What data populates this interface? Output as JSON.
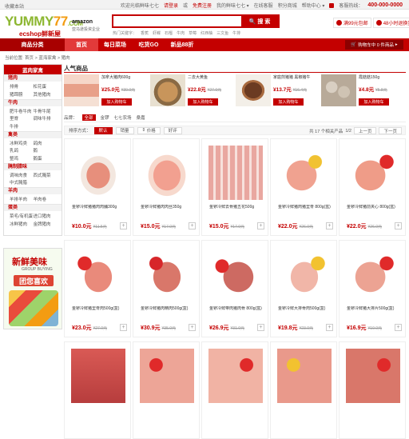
{
  "topbar": {
    "left": "收藏本站",
    "welcome": "欢迎光临鲜味七七",
    "login": "请登录",
    "or": "或",
    "register": "免费注册",
    "my": "我的鲜味七七 ▾",
    "orders": "在线客服",
    "points": "积分商城",
    "help": "帮助中心 ▾",
    "phone_label": "客服热线：",
    "phone": "400-000-0000"
  },
  "logo": {
    "brand_a": "YUMMY",
    "brand_b": "77",
    "brand_c": ".COM",
    "sub": "ecshop鲜新屋"
  },
  "amazon": {
    "name": "amazon",
    "desc": "亚马逊投资企业"
  },
  "search": {
    "placeholder": "",
    "button": "搜 索"
  },
  "hotwords": [
    "热门关键字：",
    "香蕉",
    "虾鲽",
    "石榴",
    "牛肉",
    "草莓",
    "红西柚",
    "三文鱼",
    "牛排"
  ],
  "badges": [
    {
      "label": "满99元包邮"
    },
    {
      "label": "48小时退换货"
    }
  ],
  "nav": {
    "category": "商品分类",
    "items": [
      "首页",
      "每日菜场",
      "吃货GO",
      "新品88折"
    ]
  },
  "cart": {
    "label": "购物车中 0 件商品",
    "arrow": "▸"
  },
  "breadcrumb": "当前位置: 首页 > 蓝海家禽 > 猪肉",
  "sidebar": {
    "title": "蓝肉家禽",
    "groups": [
      {
        "name": "猪肉",
        "links": [
          "排骨",
          "松花蛋",
          "猪蹄膀",
          "其他猪肉"
        ]
      },
      {
        "name": "牛肉",
        "links": [
          "肥牛卷牛肉",
          "牛骨牛尾",
          "里脊",
          "调味牛排",
          "牛排",
          ""
        ]
      },
      {
        "name": "禽类",
        "links": [
          "冰鲜鸡类",
          "鸽肉",
          "乳鸽",
          "鹅",
          "整鸡",
          "鹅蛋"
        ]
      },
      {
        "name": "腌制腊味",
        "links": [
          "调味肉食",
          "西式腌菜",
          "中式腌腊",
          ""
        ]
      },
      {
        "name": "羊肉",
        "links": [
          "羊排羊肉",
          "羊肉卷"
        ]
      },
      {
        "name": "蛋类",
        "links": [
          "菜毛/有机蛋",
          "进口猪肉",
          "冰鲜猪肉",
          "金牌猪肉"
        ]
      }
    ]
  },
  "promo": {
    "title": "新鲜美味",
    "sub": "GROUP BUYING",
    "cta": "团您喜欢"
  },
  "hot": {
    "title": "人气商品",
    "add_label": "加入购物车",
    "items": [
      {
        "name": "加拿大猪肉600g",
        "price": "¥25.0元",
        "old": "¥30.0元"
      },
      {
        "name": "二去大黄鱼",
        "price": "¥22.8元",
        "old": "¥27.0元"
      },
      {
        "name": "家庭煎猪猪 黑椒猪牛",
        "price": "¥13.7元",
        "old": "¥16.4元"
      },
      {
        "name": "霞菇菇150g",
        "price": "¥4.8元",
        "old": "¥5.8元"
      }
    ]
  },
  "brands": {
    "label": "品牌：",
    "tags": [
      "全部",
      "金锣",
      "七七农场",
      "桑嘉"
    ]
  },
  "sort": {
    "label": "排序方式：",
    "buttons": [
      "默认",
      "销量",
      "价格",
      "好评"
    ],
    "count_text": "共 17 个相关产品",
    "page": "1/2",
    "prev": "上一页",
    "next": "下一页"
  },
  "products": [
    {
      "name": "金锣冷鲜猪猪肉肉脯300g",
      "price": "¥10.0元",
      "old": "¥11.5元"
    },
    {
      "name": "金锣冷鲜猪肉肉丝350g",
      "price": "¥15.0元",
      "old": "¥17.0元"
    },
    {
      "name": "金锣冷鲜去骨猪五花500g",
      "price": "¥15.0元",
      "old": "¥17.0元"
    },
    {
      "name": "金锣冷鲜猪肉猪里脊 800g(盒)",
      "price": "¥22.0元",
      "old": "¥26.0元"
    },
    {
      "name": "金锣冷鲜猪前夹心 800g(盒)",
      "price": "¥22.0元",
      "old": "¥26.0元"
    },
    {
      "name": "金锣冷鲜猪里脊肉500g(盒)",
      "price": "¥23.0元",
      "old": "¥27.0元"
    },
    {
      "name": "金锣冷鲜猪肉精肉500g(盒)",
      "price": "¥30.9元",
      "old": "¥35.0元"
    },
    {
      "name": "金锣冷鲜带肉猪肉骨 800g(盒)",
      "price": "¥26.9元",
      "old": "¥31.0元"
    },
    {
      "name": "金锣冷鲜大排骨肉500g(盒)",
      "price": "¥19.8元",
      "old": "¥23.0元"
    },
    {
      "name": "金锣冷鲜猪大排片500g(盒)",
      "price": "¥16.9元",
      "old": "¥19.0元"
    },
    {
      "name": "",
      "price": "",
      "old": ""
    },
    {
      "name": "",
      "price": "",
      "old": ""
    },
    {
      "name": "",
      "price": "",
      "old": ""
    },
    {
      "name": "",
      "price": "",
      "old": ""
    },
    {
      "name": "",
      "price": "",
      "old": ""
    }
  ],
  "colors": {
    "accent": "#c40000",
    "nav_dark": "#a80000",
    "brand_green": "#8db732"
  }
}
